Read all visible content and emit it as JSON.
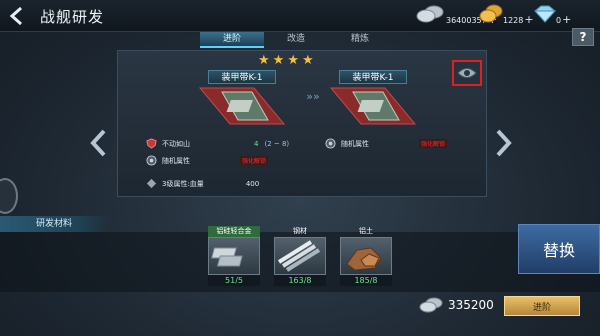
{
  "header": {
    "title": "战舰研发",
    "resources": [
      {
        "icon": "silver-coins-icon",
        "amount": "36400357",
        "plus": "+"
      },
      {
        "icon": "gold-coins-icon",
        "amount": "1228",
        "plus": "+"
      },
      {
        "icon": "diamond-icon",
        "amount": "0",
        "plus": "+"
      }
    ],
    "help_label": "?"
  },
  "tabs": [
    {
      "label": "进阶",
      "active": true
    },
    {
      "label": "改造",
      "active": false
    },
    {
      "label": "精炼",
      "active": false
    }
  ],
  "upgrade": {
    "stars": 4,
    "from_item": {
      "name": "装甲带K-1"
    },
    "to_item": {
      "name": "装甲带K-1"
    },
    "stats": {
      "left1": {
        "name": "不动如山",
        "value": "4",
        "range": "(2 ~ 8)"
      },
      "left2": {
        "name": "随机属性",
        "tag": "强化解锁"
      },
      "right1": {
        "name": "随机属性",
        "tag": "强化解锁"
      },
      "left3": {
        "name": "3级属性:血量",
        "value": "400"
      }
    }
  },
  "materials_section": {
    "label": "研发材料"
  },
  "materials": [
    {
      "name": "铝硅轻合金",
      "count": "51/5"
    },
    {
      "name": "钢材",
      "count": "163/8"
    },
    {
      "name": "铝土",
      "count": "185/8"
    }
  ],
  "actions": {
    "replace_label": "替换",
    "cost": "335200",
    "advance_label": "进阶"
  },
  "colors": {
    "accent_blue": "#5ad2ff",
    "highlight_red": "#e02020",
    "count_green": "#6fe28d",
    "advance_gold": "#e7c06a"
  }
}
